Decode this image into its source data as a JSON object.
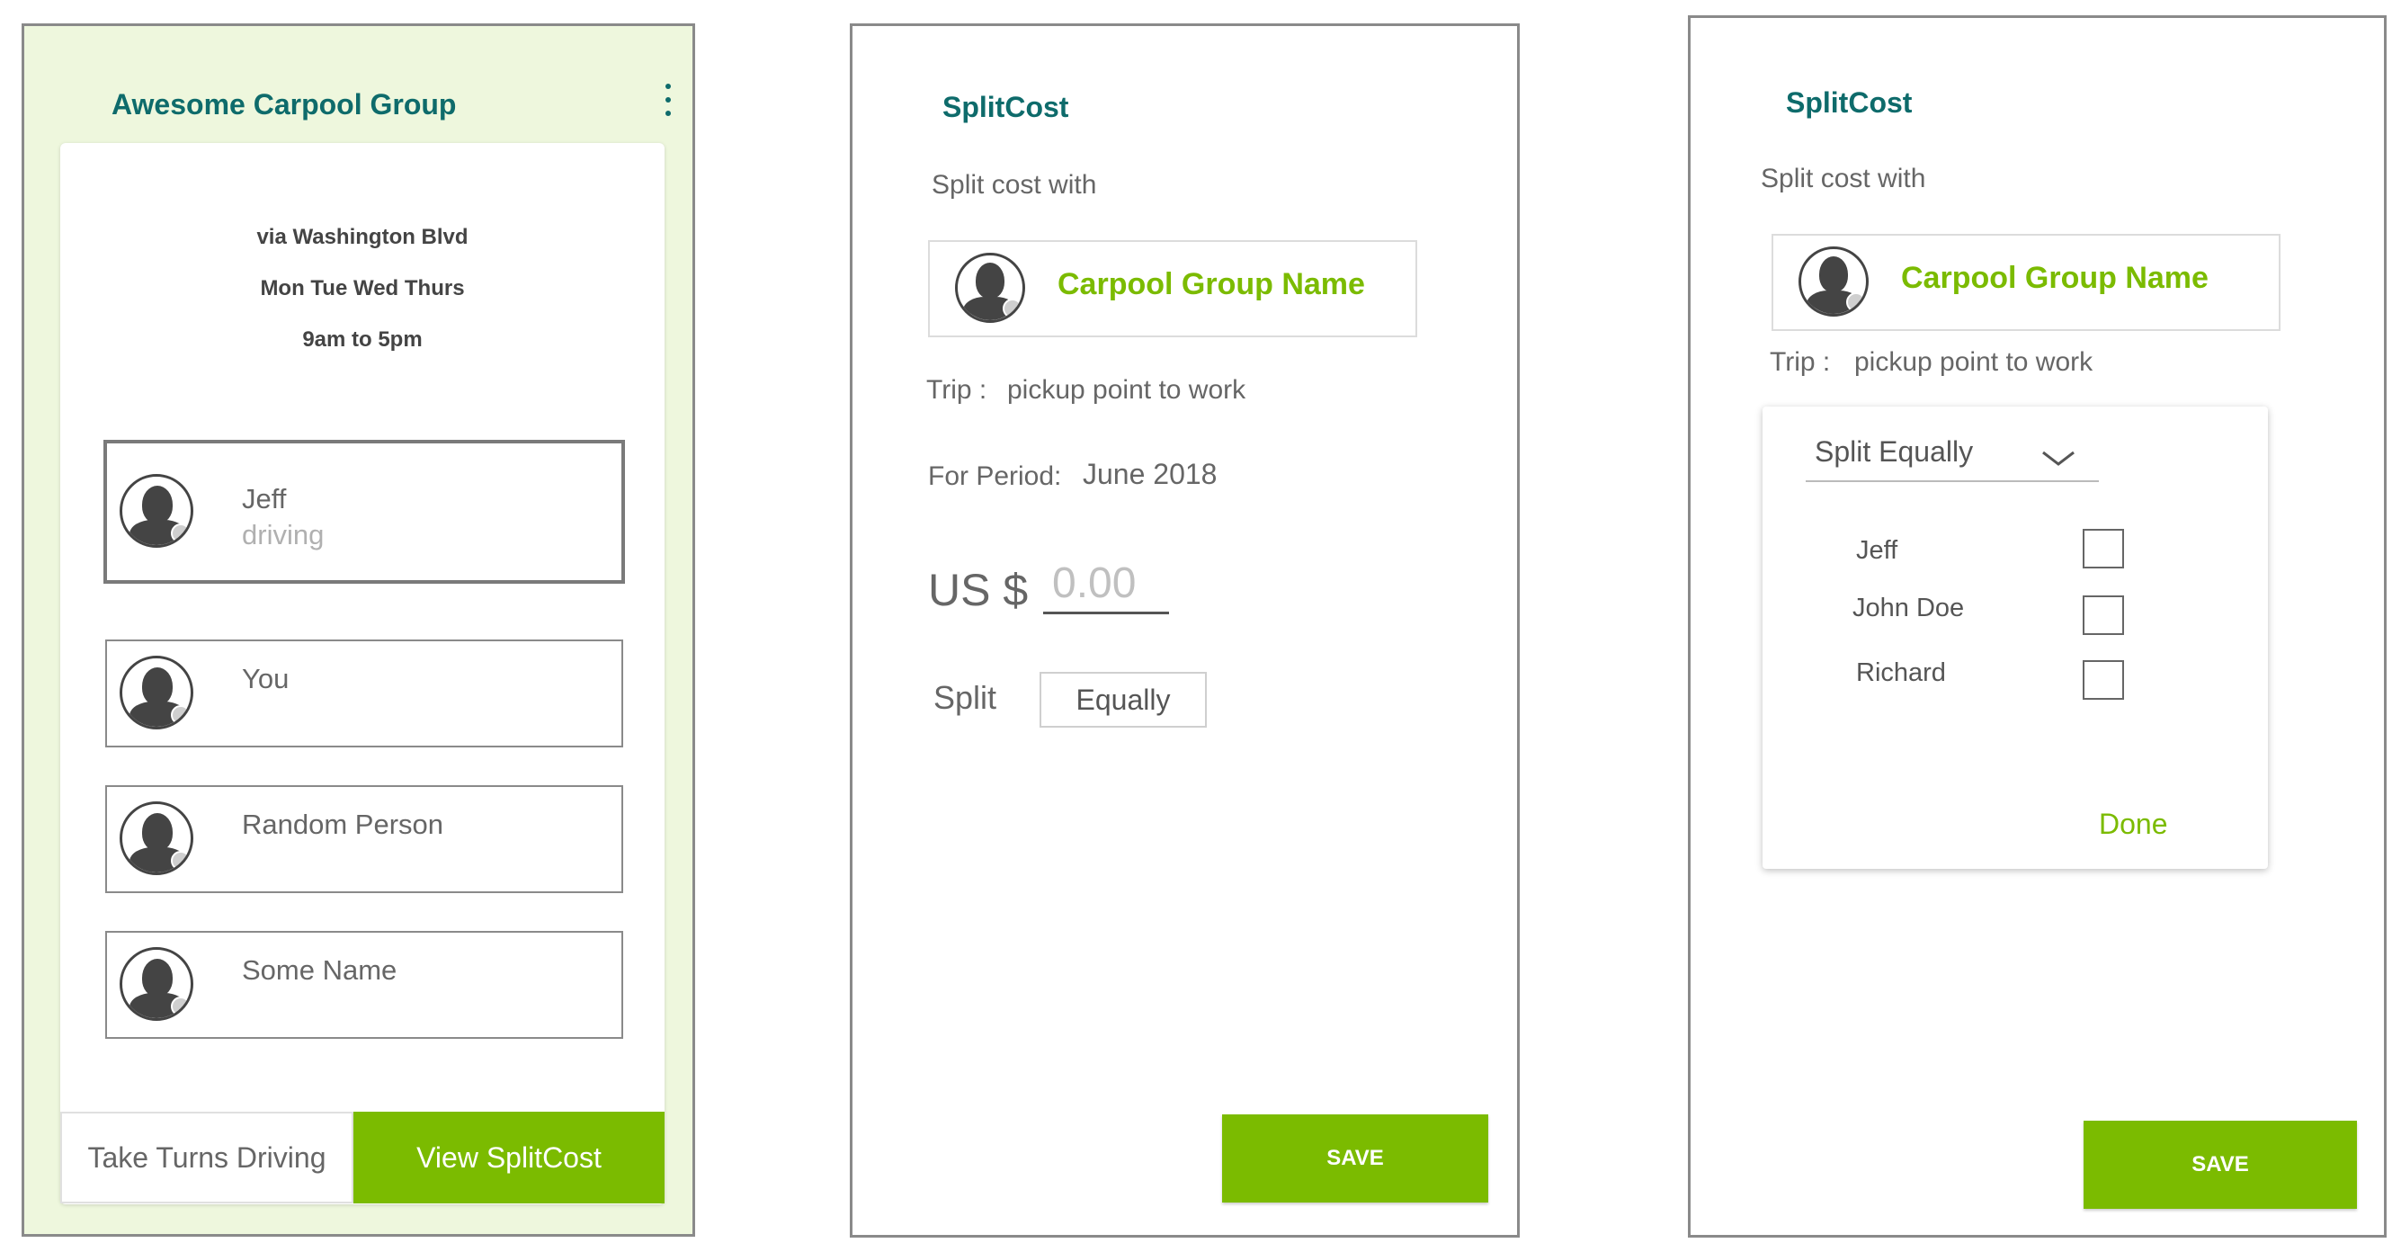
{
  "screen1": {
    "group_title": "Awesome Carpool Group",
    "menu_icon": "more-vertical-icon",
    "route": "via Washington Blvd",
    "days": "Mon Tue Wed Thurs",
    "hours": "9am to 5pm",
    "members": [
      {
        "name": "Jeff",
        "status": "driving"
      },
      {
        "name": "You"
      },
      {
        "name": "Random Person"
      },
      {
        "name": "Some Name"
      }
    ],
    "take_turns_label": "Take Turns Driving",
    "view_splitcost_label": "View SplitCost"
  },
  "screen2": {
    "app_title": "SplitCost",
    "split_cost_with_label": "Split cost with",
    "group_name": "Carpool Group Name",
    "trip_label": "Trip :",
    "trip_value": "pickup point to work",
    "period_label": "For Period:",
    "period_value": "June 2018",
    "currency_label": "US $",
    "amount_placeholder": "0.00",
    "split_label": "Split",
    "split_value": "Equally",
    "save_label": "SAVE"
  },
  "screen3": {
    "app_title": "SplitCost",
    "split_cost_with_label": "Split cost with",
    "group_name": "Carpool Group Name",
    "trip_label": "Trip :",
    "trip_value": "pickup point  to work",
    "dropdown_value": "Split Equally",
    "people": [
      {
        "name": "Jeff",
        "checked": false
      },
      {
        "name": "John Doe",
        "checked": false
      },
      {
        "name": "Richard",
        "checked": false
      }
    ],
    "done_label": "Done",
    "save_label": "SAVE"
  },
  "colors": {
    "accent_green": "#7bbb00",
    "title_teal": "#0e6b6b",
    "panel_bg": "#eef7dd"
  }
}
